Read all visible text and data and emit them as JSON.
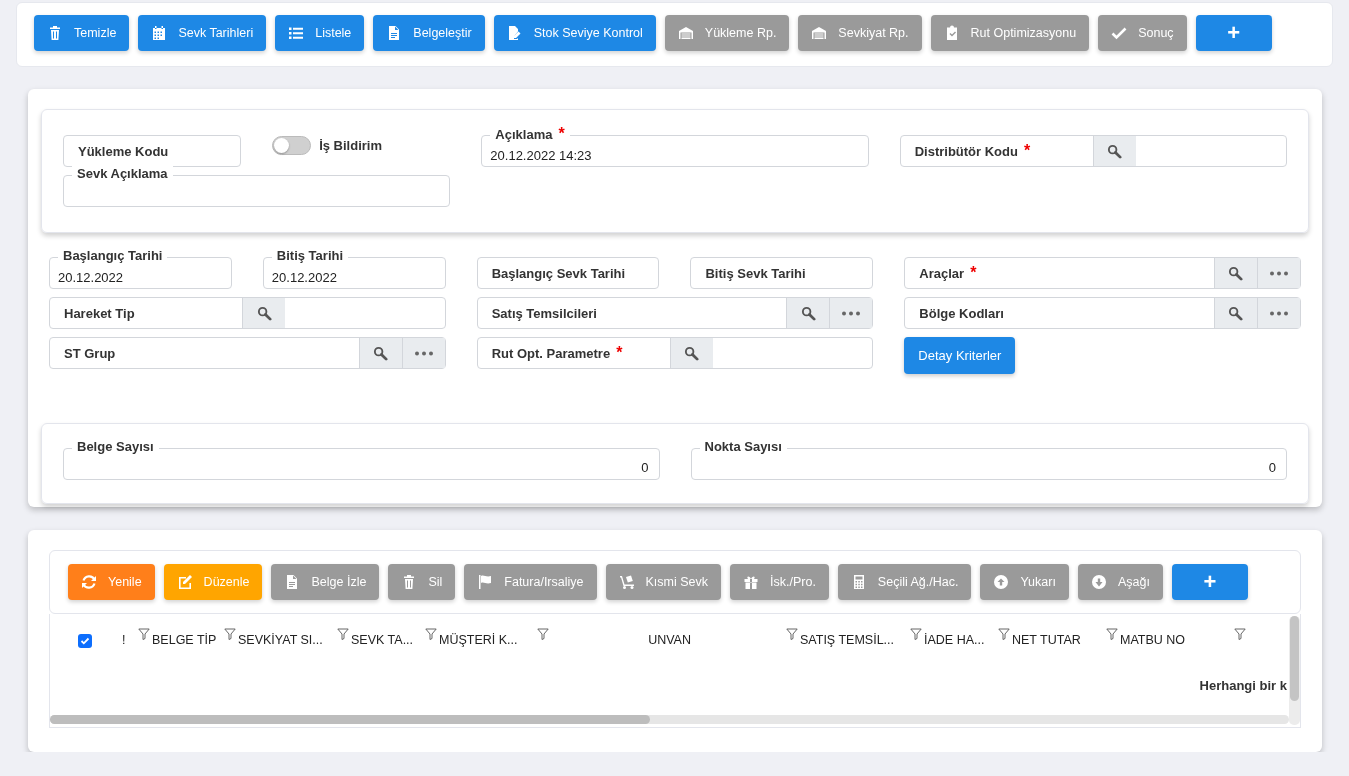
{
  "toolbar": {
    "buttons": [
      {
        "label": "Temizle",
        "color": "#1e88e5"
      },
      {
        "label": "Sevk Tarihleri",
        "color": "#1e88e5"
      },
      {
        "label": "Listele",
        "color": "#1e88e5"
      },
      {
        "label": "Belgeleştir",
        "color": "#1e88e5"
      },
      {
        "label": "Stok Seviye Kontrol",
        "color": "#1e88e5"
      },
      {
        "label": "Yükleme Rp.",
        "color": "#9a9a9a"
      },
      {
        "label": "Sevkiyat Rp.",
        "color": "#9a9a9a"
      },
      {
        "label": "Rut Optimizasyonu",
        "color": "#9a9a9a"
      },
      {
        "label": "Sonuç",
        "color": "#9a9a9a"
      },
      {
        "label": "+",
        "color": "#1e88e5"
      }
    ]
  },
  "header_form": {
    "fields": [
      {
        "kind": "plain",
        "label": "Yükleme Kodu"
      },
      {
        "kind": "toggle",
        "label": "İş Bildirim",
        "on": false
      },
      {
        "kind": "floating",
        "label": "Açıklama",
        "required_mark": "*",
        "value": "20.12.2022 14:23"
      },
      {
        "kind": "lookup",
        "label": "Distribütör Kodu",
        "required_mark": "*"
      },
      {
        "kind": "floating",
        "label": "Sevk Açıklama"
      }
    ]
  },
  "filters": {
    "fields": [
      {
        "kind": "floating",
        "label": "Başlangıç Tarihi",
        "value": "20.12.2022"
      },
      {
        "kind": "floating",
        "label": "Bitiş Tarihi",
        "value": "20.12.2022"
      },
      {
        "kind": "plain",
        "label": "Başlangıç Sevk Tarihi"
      },
      {
        "kind": "plain",
        "label": "Bitiş Sevk Tarihi"
      },
      {
        "kind": "lookup_more",
        "label": "Araçlar",
        "required_mark": "*"
      },
      {
        "kind": "lookup",
        "label": "Hareket Tip"
      },
      {
        "kind": "lookup_more",
        "label": "Satış Temsilcileri"
      },
      {
        "kind": "lookup_more",
        "label": "Bölge Kodları"
      },
      {
        "kind": "lookup_more",
        "label": "ST Grup"
      },
      {
        "kind": "lookup",
        "label": "Rut Opt. Parametre",
        "required_mark": "*"
      },
      {
        "kind": "button",
        "label": "Detay Kriterler"
      }
    ]
  },
  "summary": {
    "fields": [
      {
        "kind": "floating",
        "label": "Belge Sayısı",
        "value": "0"
      },
      {
        "kind": "floating",
        "label": "Nokta Sayısı",
        "value": "0"
      }
    ]
  },
  "grid_toolbar": {
    "buttons": [
      {
        "label": "Yenile",
        "color": "#ff7f1a"
      },
      {
        "label": "Düzenle",
        "color": "#ffa500"
      },
      {
        "label": "Belge İzle",
        "color": "#9a9a9a"
      },
      {
        "label": "Sil",
        "color": "#9a9a9a"
      },
      {
        "label": "Fatura/Irsaliye",
        "color": "#9a9a9a"
      },
      {
        "label": "Kısmi Sevk",
        "color": "#9a9a9a"
      },
      {
        "label": "İsk./Pro.",
        "color": "#9a9a9a"
      },
      {
        "label": "Seçili Ağ./Hac.",
        "color": "#9a9a9a"
      },
      {
        "label": "Yukarı",
        "color": "#9a9a9a"
      },
      {
        "label": "Aşağı",
        "color": "#9a9a9a"
      },
      {
        "label": "+",
        "color": "#1e88e5"
      }
    ]
  },
  "grid": {
    "select_all_checked": true,
    "columns": [
      "!",
      "BELGE TİP",
      "SEVKİYAT SI...",
      "SEVK TA...",
      "MÜŞTERİ K...",
      "UNVAN",
      "SATIŞ TEMSİL...",
      "İADE HA...",
      "NET TUTAR",
      "MATBU NO"
    ],
    "empty_message": "Herhangi bir k"
  }
}
